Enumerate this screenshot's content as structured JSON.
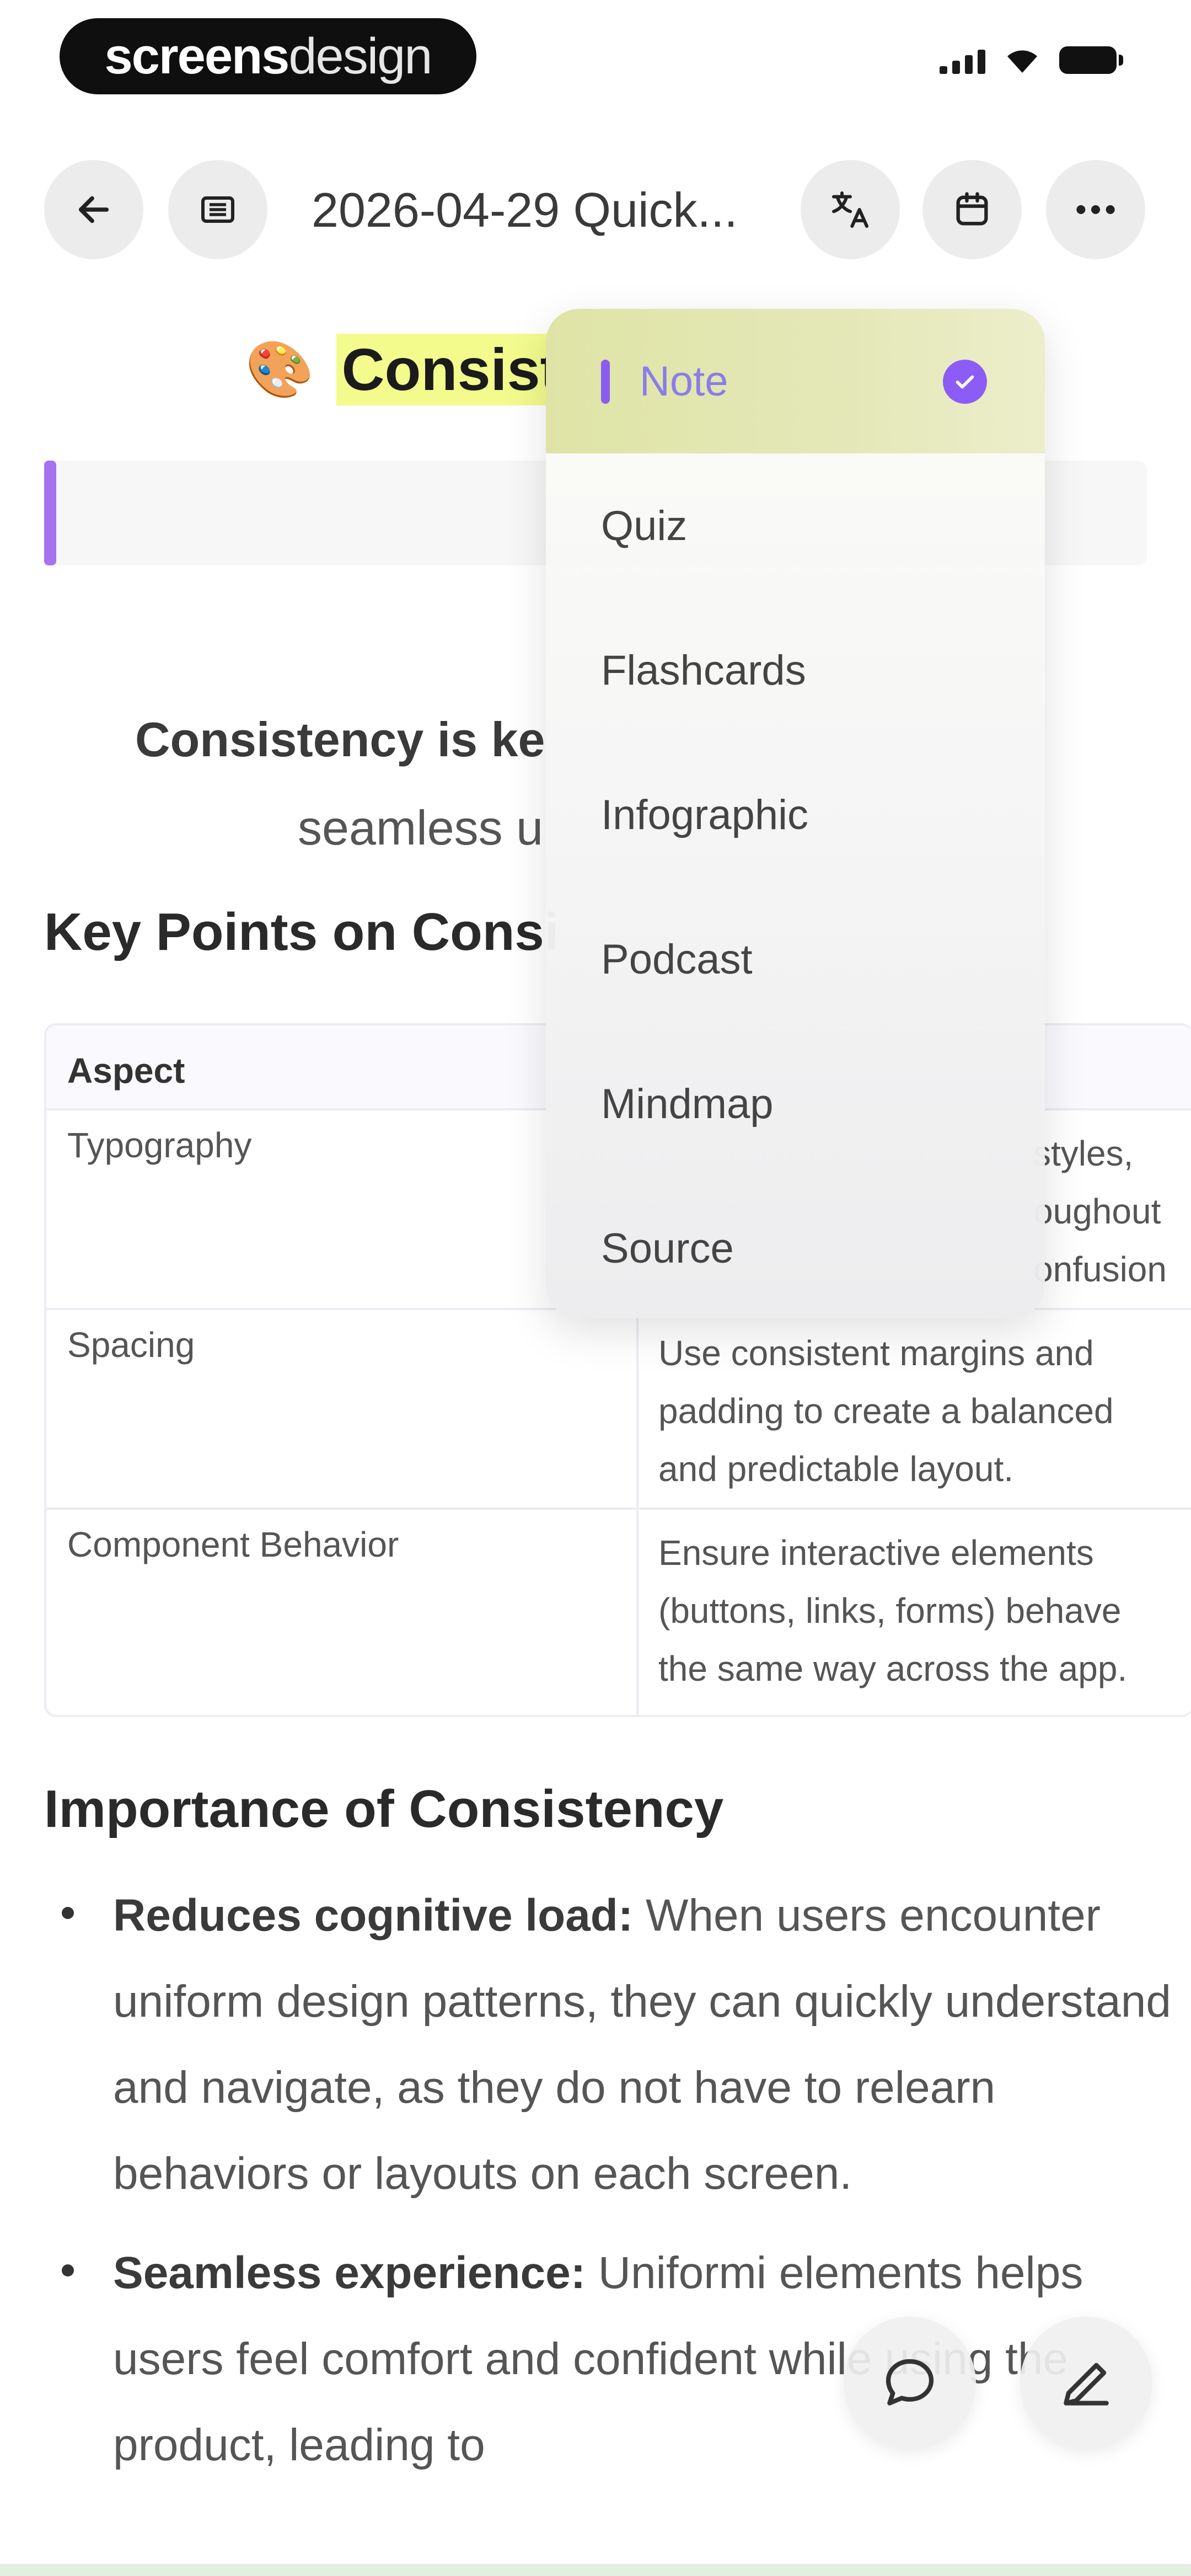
{
  "status_bar": {
    "brand_part1": "screens",
    "brand_part2": "design"
  },
  "nav": {
    "doc_title": "2026-04-29 Quick...",
    "icons": [
      "back-arrow-icon",
      "list-icon",
      "translate-icon",
      "calendar-icon",
      "more-icon"
    ]
  },
  "page": {
    "emoji": "🎨",
    "title": "Consist",
    "lead_bold": "Consistency is ke",
    "lead_rest": "seamless u",
    "heading_key_points": "Key Points on Consi",
    "heading_importance": "Importance of Consistency"
  },
  "table": {
    "header": "Aspect",
    "rows": [
      {
        "aspect": "Typography",
        "detail": [
          "styles,",
          "oughout",
          "onfusion"
        ]
      },
      {
        "aspect": "Spacing",
        "detail": [
          "Use consistent margins and",
          "padding to create a balanced",
          "and predictable layout."
        ]
      },
      {
        "aspect": "Component Behavior",
        "detail": [
          "Ensure interactive elements",
          "(buttons, links, forms) behave",
          "the same way across the app."
        ]
      }
    ]
  },
  "bullets": [
    {
      "bold": "Reduces cognitive load:",
      "text": " When users encounter uniform design patterns, they can quickly understand and navigate, as they do not have to relearn behaviors or layouts on each screen."
    },
    {
      "bold": "Seamless experience:",
      "text": " Uniformi elements helps users feel comfort and confident while using the product, leading to"
    }
  ],
  "menu": {
    "items": [
      "Note",
      "Quiz",
      "Flashcards",
      "Infographic",
      "Podcast",
      "Mindmap",
      "Source"
    ],
    "selected": "Note"
  },
  "fabs": [
    "chat-icon",
    "pencil-icon"
  ],
  "colors": {
    "highlight": "#f2fb8c",
    "accent_purple": "#8b5cf6",
    "menu_selected_bg": "#e2e6ae"
  }
}
